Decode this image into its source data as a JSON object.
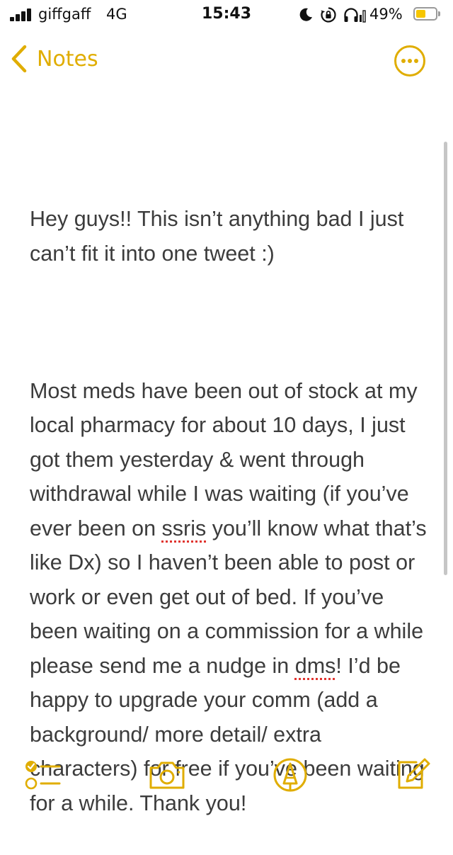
{
  "status_bar": {
    "carrier": "giffgaff",
    "network": "4G",
    "time": "15:43",
    "battery_percent": "49%",
    "battery_level": 0.49,
    "battery_color": "#f7c600",
    "icons": [
      "cellular-signal-icon",
      "do-not-disturb-moon-icon",
      "rotation-lock-icon",
      "headphones-icon",
      "battery-icon"
    ]
  },
  "nav": {
    "back_label": "Notes",
    "accent_color": "#e0ad00"
  },
  "note": {
    "paragraph1": "Hey guys!! This isn’t anything bad I just can’t fit it into one tweet :)",
    "p2_part1": "Most meds have been out of stock at my local pharmacy for about 10 days, I just got them yesterday & went through withdrawal while I was waiting (if you’ve ever been on ",
    "p2_misspelled1": "ssris",
    "p2_part2": " you’ll know what that’s like Dx) so I haven’t been able to post or work or even get out of bed. If you’ve been waiting on a commission for a while please send me a nudge in ",
    "p2_misspelled2": "dms",
    "p2_part3": "! I’d be happy to upgrade your comm (add a background/ more detail/ extra characters) for free if you’ve been waiting for a while. Thank you!"
  },
  "toolbar": {
    "icons": [
      "checklist-icon",
      "camera-icon",
      "markup-pen-icon",
      "compose-icon"
    ]
  }
}
